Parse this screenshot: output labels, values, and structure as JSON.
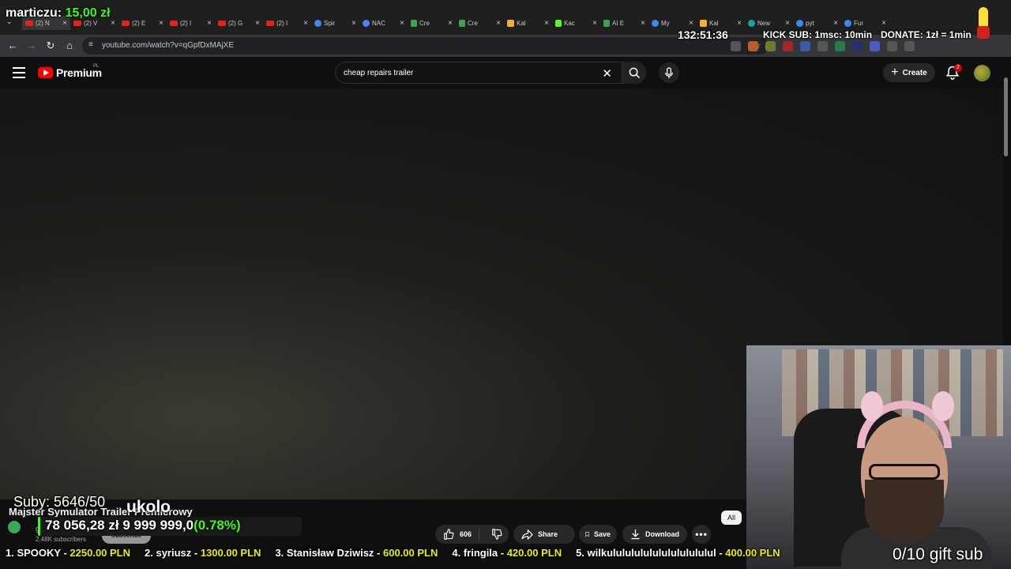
{
  "browser": {
    "tabs": [
      {
        "label": "(2) N",
        "favicon": "youtube-favicon",
        "active": true
      },
      {
        "label": "(2) V",
        "favicon": "youtube-favicon",
        "active": false
      },
      {
        "label": "(2) E",
        "favicon": "youtube-favicon",
        "active": false
      },
      {
        "label": "(2) I",
        "favicon": "youtube-favicon",
        "active": false
      },
      {
        "label": "(2) G",
        "favicon": "youtube-favicon",
        "active": false
      },
      {
        "label": "(2) I",
        "favicon": "youtube-favicon",
        "active": false
      },
      {
        "label": "Spir",
        "favicon": "chrome-favicon",
        "active": false
      },
      {
        "label": "NAC",
        "favicon": "globe-favicon",
        "active": false
      },
      {
        "label": "Cre",
        "favicon": "sheets-favicon",
        "active": false
      },
      {
        "label": "Cre",
        "favicon": "sheets-favicon",
        "active": false
      },
      {
        "label": "Kal",
        "favicon": "calendar-favicon",
        "active": false
      },
      {
        "label": "Kac",
        "favicon": "kick-favicon",
        "active": false
      },
      {
        "label": "AI E",
        "favicon": "sheets-favicon",
        "active": false
      },
      {
        "label": "My",
        "favicon": "globe-favicon",
        "active": false
      },
      {
        "label": "Kal",
        "favicon": "calendar-favicon",
        "active": false
      },
      {
        "label": "New",
        "favicon": "chatgpt-favicon",
        "active": false
      },
      {
        "label": "pyt",
        "favicon": "google-favicon",
        "active": false
      },
      {
        "label": "Fur",
        "favicon": "steam-favicon",
        "active": false
      }
    ],
    "url": "youtube.com/watch?v=qGpfDxMAjXE"
  },
  "youtube": {
    "logo_text": "Premium",
    "country_code": "PL",
    "search_query": "cheap repairs trailer",
    "create_label": "Create",
    "notification_count": "2",
    "video_title": "Majster Symulator Trailer Premierowy",
    "channel_name": "gra",
    "subscriber_count": "2.48K subscribers",
    "subscribe_label": "Subscribe",
    "like_count": "606",
    "share_label": "Share",
    "save_label": "Save",
    "download_label": "Download",
    "chip_all": "All"
  },
  "overlay": {
    "donor": "marticzu:",
    "donor_amount": "15,00 zł",
    "timer": "132:51:36",
    "kick_sub": "KICK SUB: 1msc: 10min",
    "donate_rate": "DONATE: 1zł = 1min",
    "subs_goal": "Suby: 5646/50",
    "ukolo": "ukolo",
    "money_current": "78 056,28 zł",
    "money_target": "9 999 999,0",
    "money_pct": "(0.78%)",
    "money_fraction": 0.0078,
    "gift_sub": "0/10 gift sub",
    "ticker": [
      {
        "name": "1. SPOOKY - ",
        "amount": "2250.00 PLN"
      },
      {
        "name": "2. syriusz - ",
        "amount": "1300.00 PLN"
      },
      {
        "name": "3. Stanisław Dziwisz - ",
        "amount": "600.00 PLN"
      },
      {
        "name": "4. fringila - ",
        "amount": "420.00 PLN"
      },
      {
        "name": "5. wilkulululululululululululul - ",
        "amount": "400.00 PLN"
      }
    ]
  }
}
